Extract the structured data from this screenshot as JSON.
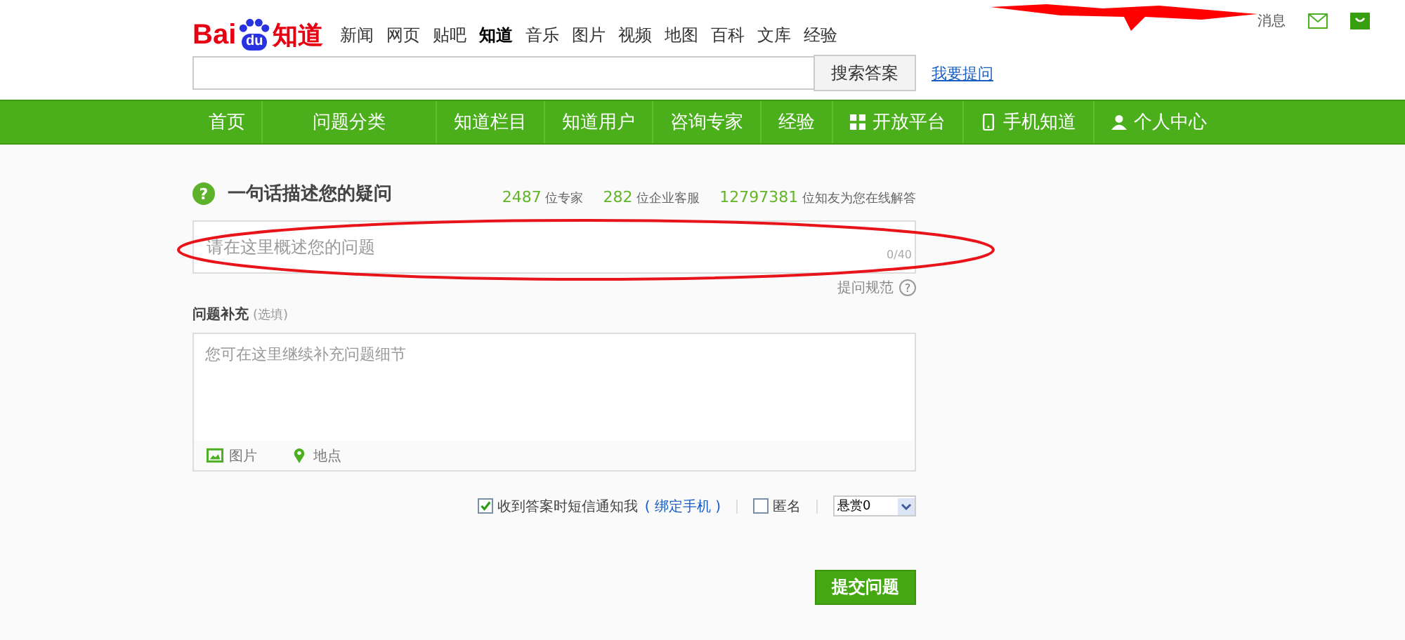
{
  "logo": {
    "part1": "Bai",
    "part2": "du",
    "part3": "知道"
  },
  "top_links": [
    {
      "label": "新闻",
      "selected": false
    },
    {
      "label": "网页",
      "selected": false
    },
    {
      "label": "贴吧",
      "selected": false
    },
    {
      "label": "知道",
      "selected": true
    },
    {
      "label": "音乐",
      "selected": false
    },
    {
      "label": "图片",
      "selected": false
    },
    {
      "label": "视频",
      "selected": false
    },
    {
      "label": "地图",
      "selected": false
    },
    {
      "label": "百科",
      "selected": false
    },
    {
      "label": "文库",
      "selected": false
    },
    {
      "label": "经验",
      "selected": false
    }
  ],
  "user_bar": {
    "messages": "消息"
  },
  "search": {
    "button": "搜索答案",
    "ask_link": "我要提问"
  },
  "nav": [
    {
      "label": "首页",
      "kind": "plain"
    },
    {
      "label": "问题分类",
      "kind": "plain"
    },
    {
      "label": "知道栏目",
      "kind": "plain"
    },
    {
      "label": "知道用户",
      "kind": "plain"
    },
    {
      "label": "咨询专家",
      "kind": "plain"
    },
    {
      "label": "经验",
      "kind": "plain"
    },
    {
      "label": "开放平台",
      "kind": "grid"
    },
    {
      "label": "手机知道",
      "kind": "phone"
    },
    {
      "label": "个人中心",
      "kind": "person"
    }
  ],
  "ask": {
    "icon": "?",
    "title": "一句话描述您的疑问",
    "stats": [
      {
        "number": "2487",
        "label": "位专家"
      },
      {
        "number": "282",
        "label": "位企业客服"
      },
      {
        "number": "12797381",
        "label": "位知友为您在线解答"
      }
    ],
    "question_placeholder": "请在这里概述您的问题",
    "counter": "0/40",
    "rules_link": "提问规范",
    "rules_help": "?",
    "detail_label": "问题补充",
    "detail_optional": "(选填)",
    "detail_placeholder": "您可在这里继续补充问题细节",
    "attach": [
      {
        "label": "图片",
        "kind": "image"
      },
      {
        "label": "地点",
        "kind": "location"
      }
    ],
    "sms_notify": {
      "label": "收到答案时短信通知我",
      "checked": true
    },
    "bind_phone": "( 绑定手机 )",
    "anonymous": {
      "label": "匿名",
      "checked": false
    },
    "reward": "悬赏0",
    "submit": "提交问题"
  }
}
